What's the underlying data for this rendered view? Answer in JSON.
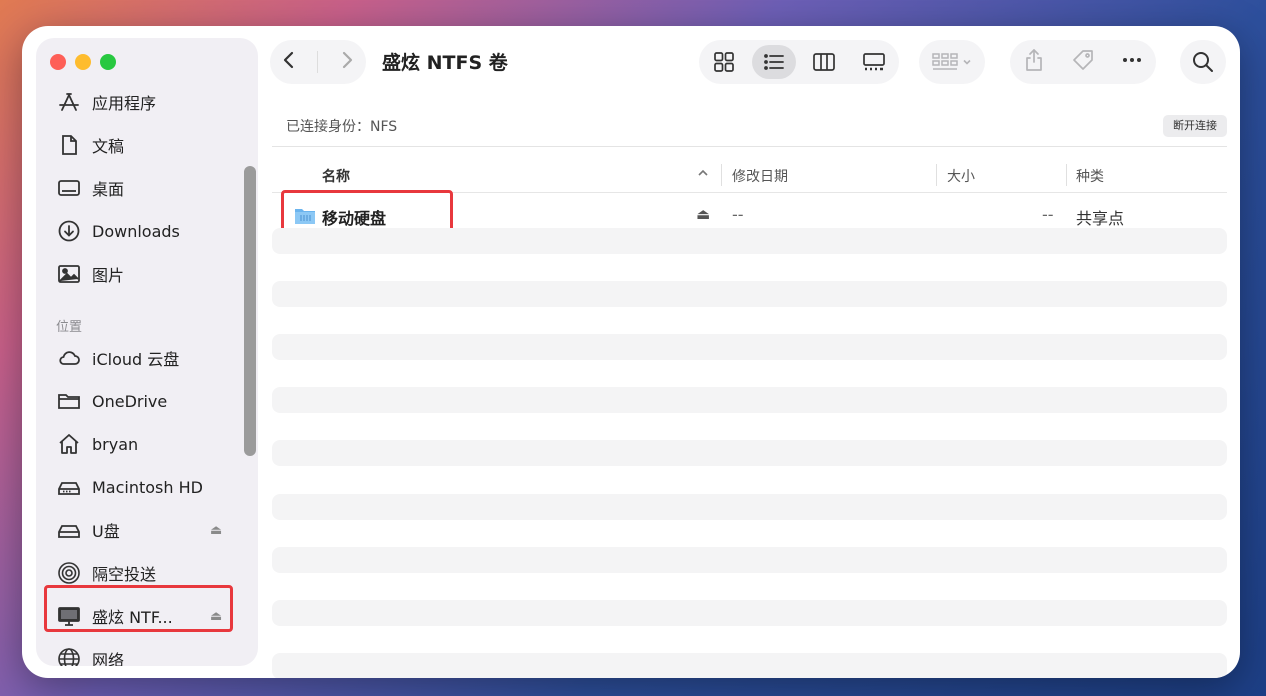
{
  "toolbar": {
    "title": "盛炫 NTFS 卷"
  },
  "connection": {
    "text": "已连接身份：NFS",
    "disconnect_label": "断开连接"
  },
  "columns": {
    "name": "名称",
    "date": "修改日期",
    "size": "大小",
    "kind": "种类"
  },
  "files": [
    {
      "name": "移动硬盘",
      "date": "--",
      "size": "--",
      "kind": "共享点"
    }
  ],
  "sidebar": {
    "favorites": [
      {
        "label": "应用程序",
        "icon": "applications-icon"
      },
      {
        "label": "文稿",
        "icon": "document-icon"
      },
      {
        "label": "桌面",
        "icon": "desktop-icon"
      },
      {
        "label": "Downloads",
        "icon": "download-icon"
      },
      {
        "label": "图片",
        "icon": "pictures-icon"
      }
    ],
    "locations_header": "位置",
    "locations": [
      {
        "label": "iCloud 云盘",
        "icon": "cloud-icon"
      },
      {
        "label": "OneDrive",
        "icon": "folder-icon"
      },
      {
        "label": "bryan",
        "icon": "home-icon"
      },
      {
        "label": "Macintosh HD",
        "icon": "hard-drive-icon"
      },
      {
        "label": "U盘",
        "icon": "external-drive-icon"
      },
      {
        "label": "隔空投送",
        "icon": "airdrop-icon"
      },
      {
        "label": "盛炫 NTF...",
        "icon": "monitor-icon"
      },
      {
        "label": "网络",
        "icon": "globe-icon"
      }
    ]
  },
  "colors": {
    "highlight": "#e8383d",
    "folder": "#6ab4ee"
  }
}
